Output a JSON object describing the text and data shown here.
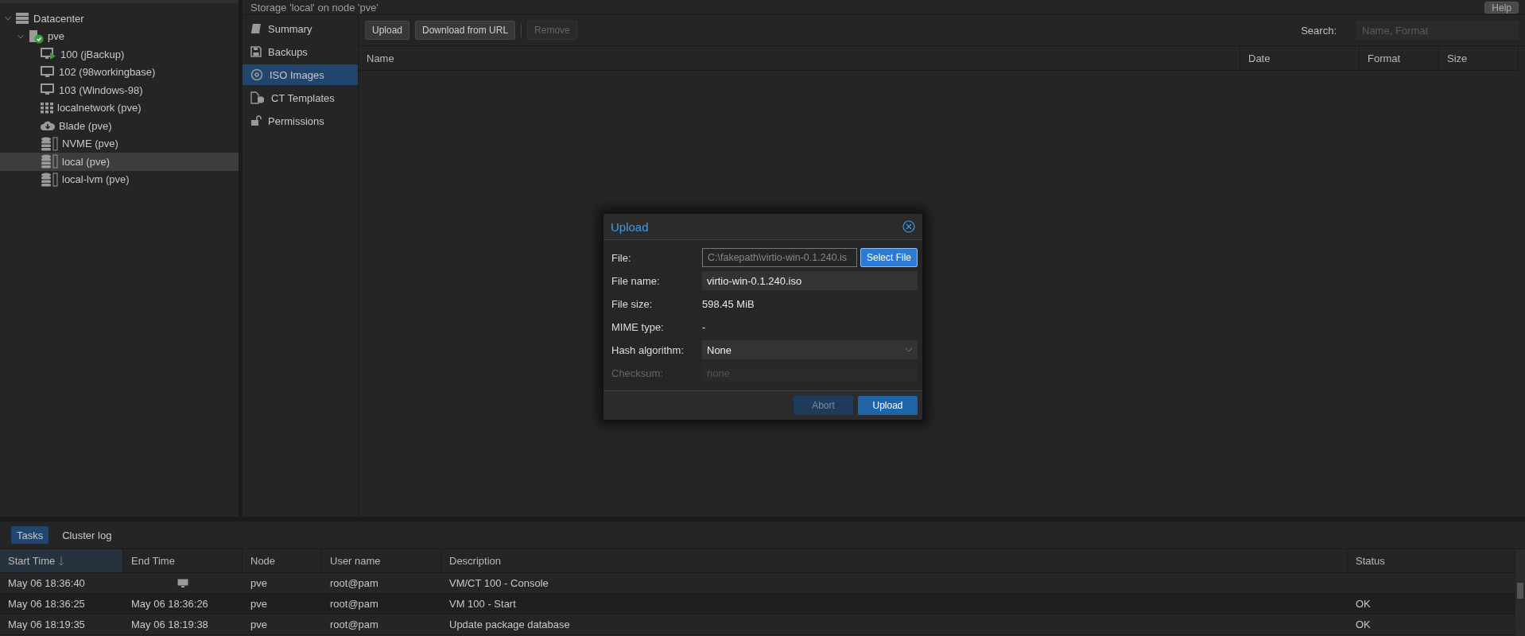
{
  "tree": [
    {
      "label": "Datacenter",
      "kind": "datacenter",
      "expanded": true,
      "selected": false,
      "children": [
        {
          "label": "pve",
          "kind": "node",
          "expanded": true,
          "selected": false,
          "children": [
            {
              "label": "100 (jBackup)",
              "kind": "vm-running",
              "selected": false
            },
            {
              "label": "102 (98workingbase)",
              "kind": "vm",
              "selected": false
            },
            {
              "label": "103 (Windows-98)",
              "kind": "vm",
              "selected": false
            },
            {
              "label": "localnetwork (pve)",
              "kind": "sdn",
              "selected": false
            },
            {
              "label": "Blade (pve)",
              "kind": "storage-cloud",
              "selected": false
            },
            {
              "label": "NVME (pve)",
              "kind": "storage",
              "selected": false
            },
            {
              "label": "local (pve)",
              "kind": "storage",
              "selected": true
            },
            {
              "label": "local-lvm (pve)",
              "kind": "storage",
              "selected": false
            }
          ]
        }
      ]
    }
  ],
  "header": {
    "title": "Storage 'local' on node 'pve'",
    "help": "Help"
  },
  "nav": [
    {
      "label": "Summary",
      "kind": "summary",
      "selected": false
    },
    {
      "label": "Backups",
      "kind": "backups",
      "selected": false
    },
    {
      "label": "ISO Images",
      "kind": "iso",
      "selected": true
    },
    {
      "label": "CT Templates",
      "kind": "templates",
      "selected": false
    },
    {
      "label": "Permissions",
      "kind": "permissions",
      "selected": false
    }
  ],
  "toolbar": {
    "buttons": [
      {
        "label": "Upload",
        "disabled": false
      },
      {
        "label": "Download from URL",
        "disabled": false
      },
      {
        "label": "Remove",
        "disabled": true
      }
    ],
    "search_label": "Search:",
    "search_placeholder": "Name, Format"
  },
  "grid": {
    "columns": [
      "Name",
      "Date",
      "Format",
      "Size"
    ]
  },
  "dialog": {
    "title": "Upload",
    "fields": [
      {
        "kind": "file",
        "label": "File:",
        "value": "C:\\fakepath\\virtio-win-0.1.240.is",
        "button": "Select File",
        "disabled": false
      },
      {
        "kind": "text",
        "label": "File name:",
        "value": "virtio-win-0.1.240.iso",
        "disabled": false
      },
      {
        "kind": "display",
        "label": "File size:",
        "value": "598.45 MiB",
        "disabled": false
      },
      {
        "kind": "display",
        "label": "MIME type:",
        "value": "-",
        "disabled": false
      },
      {
        "kind": "select",
        "label": "Hash algorithm:",
        "value": "None",
        "disabled": false
      },
      {
        "kind": "text",
        "label": "Checksum:",
        "placeholder": "none",
        "disabled": true
      }
    ],
    "buttons": [
      {
        "label": "Abort",
        "disabled": true
      },
      {
        "label": "Upload",
        "disabled": false
      }
    ]
  },
  "tasks": {
    "tabs": [
      {
        "label": "Tasks",
        "selected": true
      },
      {
        "label": "Cluster log",
        "selected": false
      }
    ],
    "columns": [
      {
        "label": "Start Time",
        "sorted": true
      },
      {
        "label": "End Time",
        "sorted": false
      },
      {
        "label": "Node",
        "sorted": false
      },
      {
        "label": "User name",
        "sorted": false
      },
      {
        "label": "Description",
        "sorted": false
      },
      {
        "label": "Status",
        "sorted": false
      }
    ],
    "rows": [
      {
        "kind": "running",
        "start": "May 06 18:36:40",
        "node": "pve",
        "user": "root@pam",
        "description": "VM/CT 100 - Console"
      },
      {
        "kind": "done",
        "start": "May 06 18:36:25",
        "end": "May 06 18:36:26",
        "node": "pve",
        "user": "root@pam",
        "description": "VM 100 - Start",
        "status": "OK"
      },
      {
        "kind": "done",
        "start": "May 06 18:19:35",
        "end": "May 06 18:19:38",
        "node": "pve",
        "user": "root@pam",
        "description": "Update package database",
        "status": "OK"
      }
    ]
  }
}
